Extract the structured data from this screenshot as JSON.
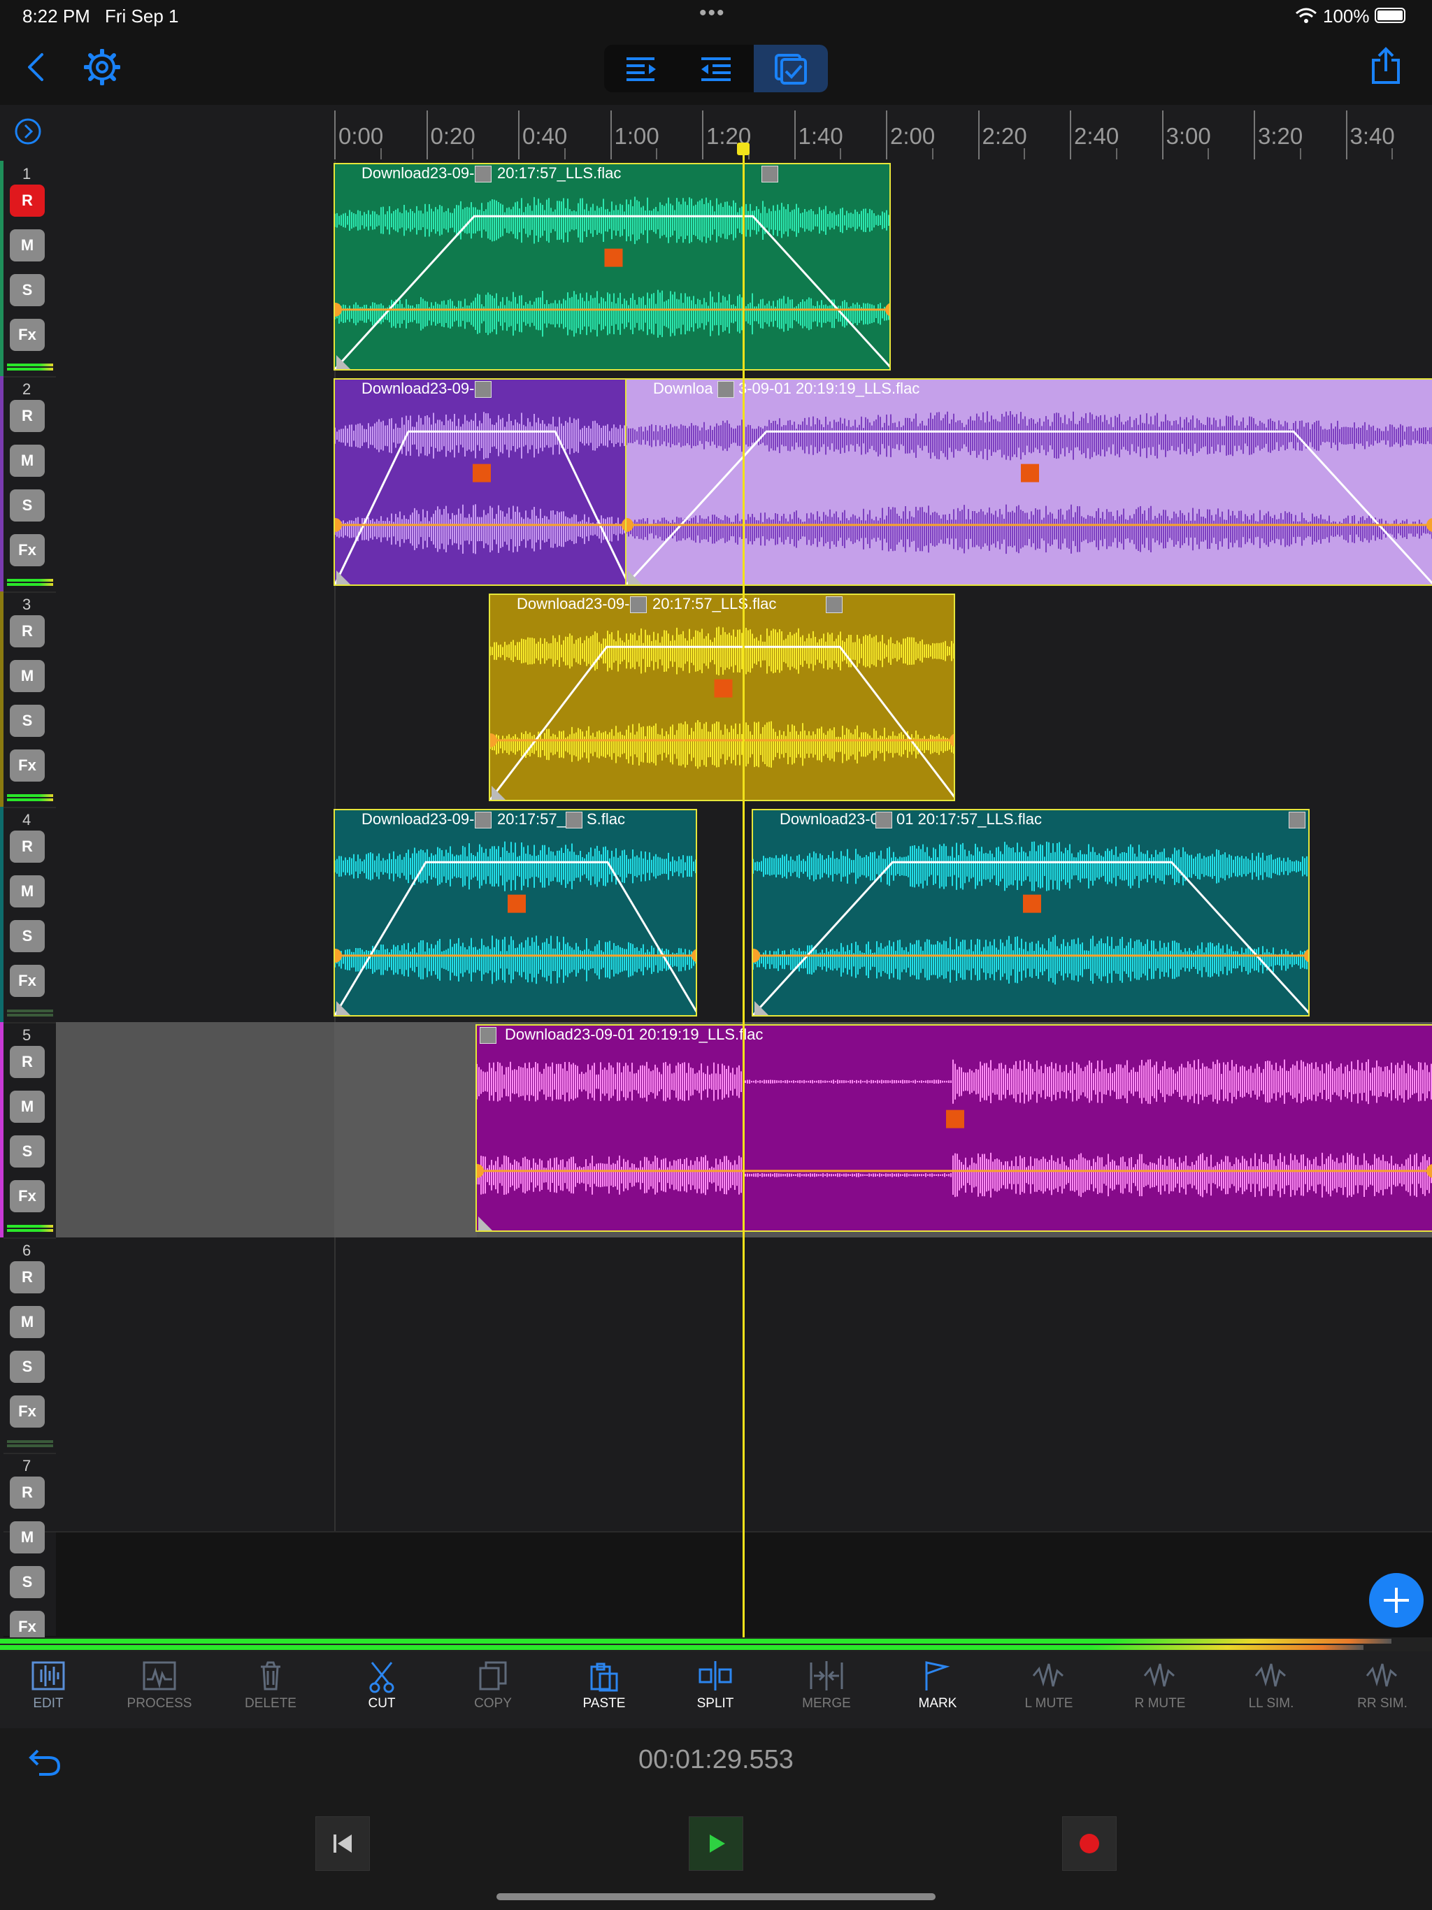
{
  "status_bar": {
    "time": "8:22 PM",
    "date": "Fri Sep 1",
    "battery": "100%"
  },
  "toolbar": {
    "back_icon": "chevron-left-icon",
    "settings_icon": "gear-icon",
    "share_icon": "share-icon",
    "modes": [
      {
        "name": "indent-right-icon"
      },
      {
        "name": "indent-left-icon"
      },
      {
        "name": "checklist-icon",
        "active": true
      }
    ]
  },
  "ruler": {
    "labels": [
      "0:00",
      "0:20",
      "0:40",
      "1:00",
      "1:20",
      "1:40",
      "2:00",
      "2:20",
      "2:40",
      "3:00",
      "3:20",
      "3:40"
    ]
  },
  "tracks": [
    {
      "number": "1",
      "rec": true,
      "color": "#1f8f5a"
    },
    {
      "number": "2",
      "rec": false,
      "color": "#7a3bb0"
    },
    {
      "number": "3",
      "rec": false,
      "color": "#8a7a10"
    },
    {
      "number": "4",
      "rec": false,
      "color": "#0e6c6c"
    },
    {
      "number": "5",
      "rec": false,
      "color": "#c83ad6"
    },
    {
      "number": "6",
      "rec": false,
      "color": "#1c1c1e"
    },
    {
      "number": "7",
      "rec": false,
      "color": "#1c1c1e"
    }
  ],
  "track_buttons": {
    "r": "R",
    "m": "M",
    "s": "S",
    "fx": "Fx"
  },
  "clips": {
    "t1": {
      "name": "Download23-09-",
      "name2": "20:17:57_LLS.flac",
      "bg": "#0f7a4d",
      "wave": "#2ce8b0"
    },
    "t2a": {
      "name": "Download23-09-",
      "bg": "#6a2eae",
      "wave": "#c89af2"
    },
    "t2b": {
      "name": "Downloa",
      "name2": "3-09-01 20:19:19_LLS.flac",
      "bg": "#c5a0ea",
      "wave": "#7d3fc0"
    },
    "t3": {
      "name": "Download23-09-",
      "name2": "20:17:57_LLS.flac",
      "bg": "#a8890a",
      "wave": "#f7ea2a"
    },
    "t4a": {
      "name": "Download23-09-",
      "name2": "20:17:57_L",
      "name3": "S.flac",
      "bg": "#0b5e62",
      "wave": "#22dfe8"
    },
    "t4b": {
      "name": "Download23-0",
      "name2": "01 20:17:57_LLS.flac",
      "bg": "#0b5e62",
      "wave": "#22dfe8"
    },
    "t5": {
      "name": "Download23-09-01 20:19:19_LLS.flac",
      "bg": "#860a8a",
      "wave": "#ff8cf5"
    }
  },
  "edit_toolbar": [
    {
      "label": "EDIT",
      "icon": "waveform-icon",
      "state": "active"
    },
    {
      "label": "PROCESS",
      "icon": "process-icon",
      "state": "dim"
    },
    {
      "label": "DELETE",
      "icon": "trash-icon",
      "state": "dim"
    },
    {
      "label": "CUT",
      "icon": "scissors-icon",
      "state": "on"
    },
    {
      "label": "COPY",
      "icon": "copy-icon",
      "state": "dim"
    },
    {
      "label": "PASTE",
      "icon": "paste-icon",
      "state": "on"
    },
    {
      "label": "SPLIT",
      "icon": "split-icon",
      "state": "on"
    },
    {
      "label": "MERGE",
      "icon": "merge-icon",
      "state": "dim"
    },
    {
      "label": "MARK",
      "icon": "flag-icon",
      "state": "on"
    },
    {
      "label": "L MUTE",
      "icon": "l-mute-icon",
      "state": "dim"
    },
    {
      "label": "R MUTE",
      "icon": "r-mute-icon",
      "state": "dim"
    },
    {
      "label": "LL SIM.",
      "icon": "ll-sim-icon",
      "state": "dim"
    },
    {
      "label": "RR SIM.",
      "icon": "rr-sim-icon",
      "state": "dim"
    }
  ],
  "transport": {
    "timecode": "00:01:29.553",
    "undo_icon": "undo-icon",
    "skip_back_icon": "skip-back-icon",
    "play_icon": "play-icon",
    "record_icon": "record-icon"
  },
  "colors": {
    "accent": "#1a82f7",
    "playhead": "#f2e21a",
    "record": "#e0181d"
  }
}
